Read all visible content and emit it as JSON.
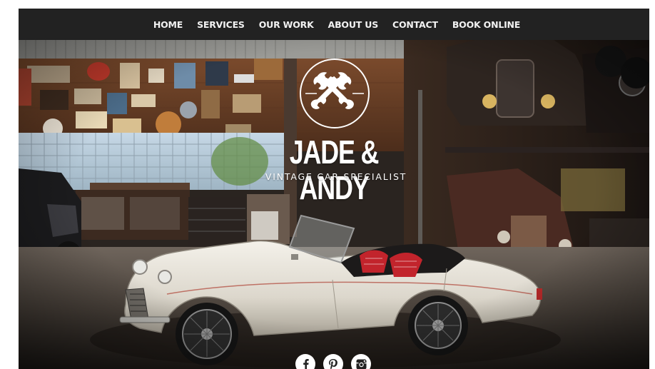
{
  "nav": {
    "items": [
      {
        "label": "HOME"
      },
      {
        "label": "SERVICES"
      },
      {
        "label": "OUR WORK"
      },
      {
        "label": "ABOUT US"
      },
      {
        "label": "CONTACT"
      },
      {
        "label": "BOOK ONLINE"
      }
    ]
  },
  "brand": {
    "title": "JADE & ANDY",
    "tagline": "VINTAGE CAR SPECIALIST",
    "emblem_icon": "crossed-wrenches-icon"
  },
  "social": [
    {
      "icon": "facebook-icon",
      "glyph": "f"
    },
    {
      "icon": "pinterest-icon",
      "glyph": "p"
    },
    {
      "icon": "instagram-icon",
      "glyph": "instagram"
    }
  ],
  "colors": {
    "nav_bg": "#222222",
    "nav_text": "#f2f2f2",
    "brand_text": "#ffffff"
  }
}
